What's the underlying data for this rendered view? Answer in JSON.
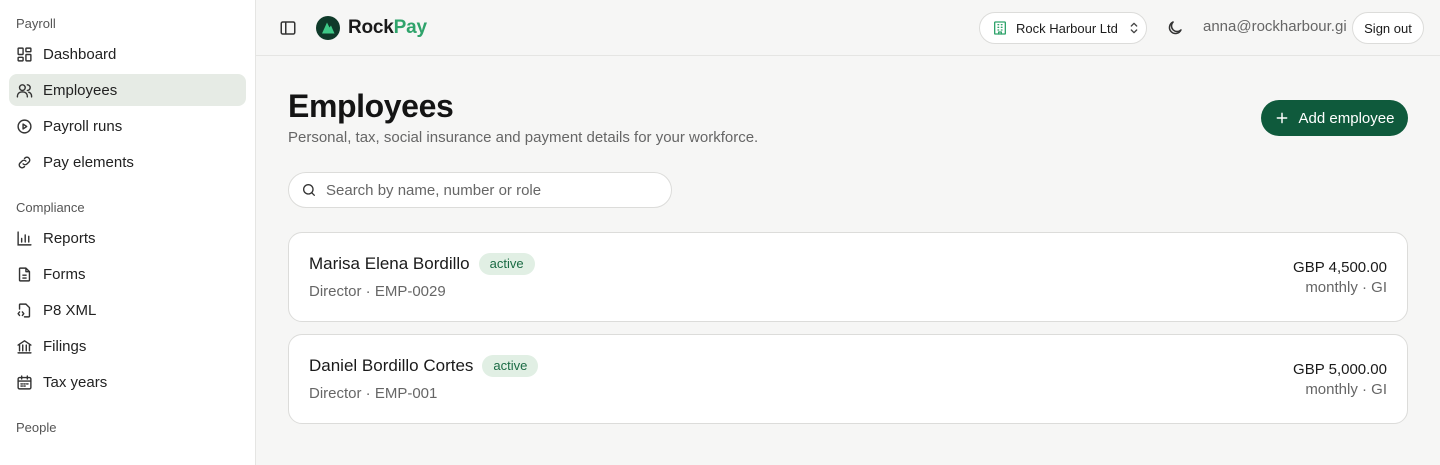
{
  "sidebar": {
    "sections": [
      {
        "label": "Payroll",
        "items": [
          {
            "label": "Dashboard",
            "icon": "dashboard-icon"
          },
          {
            "label": "Employees",
            "icon": "users-icon",
            "active": true
          },
          {
            "label": "Payroll runs",
            "icon": "play-circle-icon"
          },
          {
            "label": "Pay elements",
            "icon": "link-icon"
          }
        ]
      },
      {
        "label": "Compliance",
        "items": [
          {
            "label": "Reports",
            "icon": "bar-chart-icon"
          },
          {
            "label": "Forms",
            "icon": "document-icon"
          },
          {
            "label": "P8 XML",
            "icon": "file-code-icon"
          },
          {
            "label": "Filings",
            "icon": "bank-icon"
          },
          {
            "label": "Tax years",
            "icon": "calendar-icon"
          }
        ]
      },
      {
        "label": "People",
        "items": []
      }
    ]
  },
  "header": {
    "brand_part1": "Rock",
    "brand_part2": "Pay",
    "company": "Rock Harbour Ltd",
    "user_email": "anna@rockharbour.gi",
    "sign_out_label": "Sign out"
  },
  "page": {
    "title": "Employees",
    "subtitle": "Personal, tax, social insurance and payment details for your workforce.",
    "add_button_label": "Add employee",
    "search_placeholder": "Search by name, number or role"
  },
  "employees": [
    {
      "name": "Marisa Elena Bordillo",
      "status": "active",
      "meta": "Director · EMP-0029",
      "pay": "GBP 4,500.00",
      "frequency": "monthly · GI"
    },
    {
      "name": "Daniel Bordillo Cortes",
      "status": "active",
      "meta": "Director · EMP-001",
      "pay": "GBP 5,000.00",
      "frequency": "monthly · GI"
    }
  ],
  "colors": {
    "brand_green": "#0f5a3c",
    "accent_green": "#2fa36b",
    "badge_bg": "#e1efe4",
    "active_nav_bg": "#e6ebe5"
  }
}
